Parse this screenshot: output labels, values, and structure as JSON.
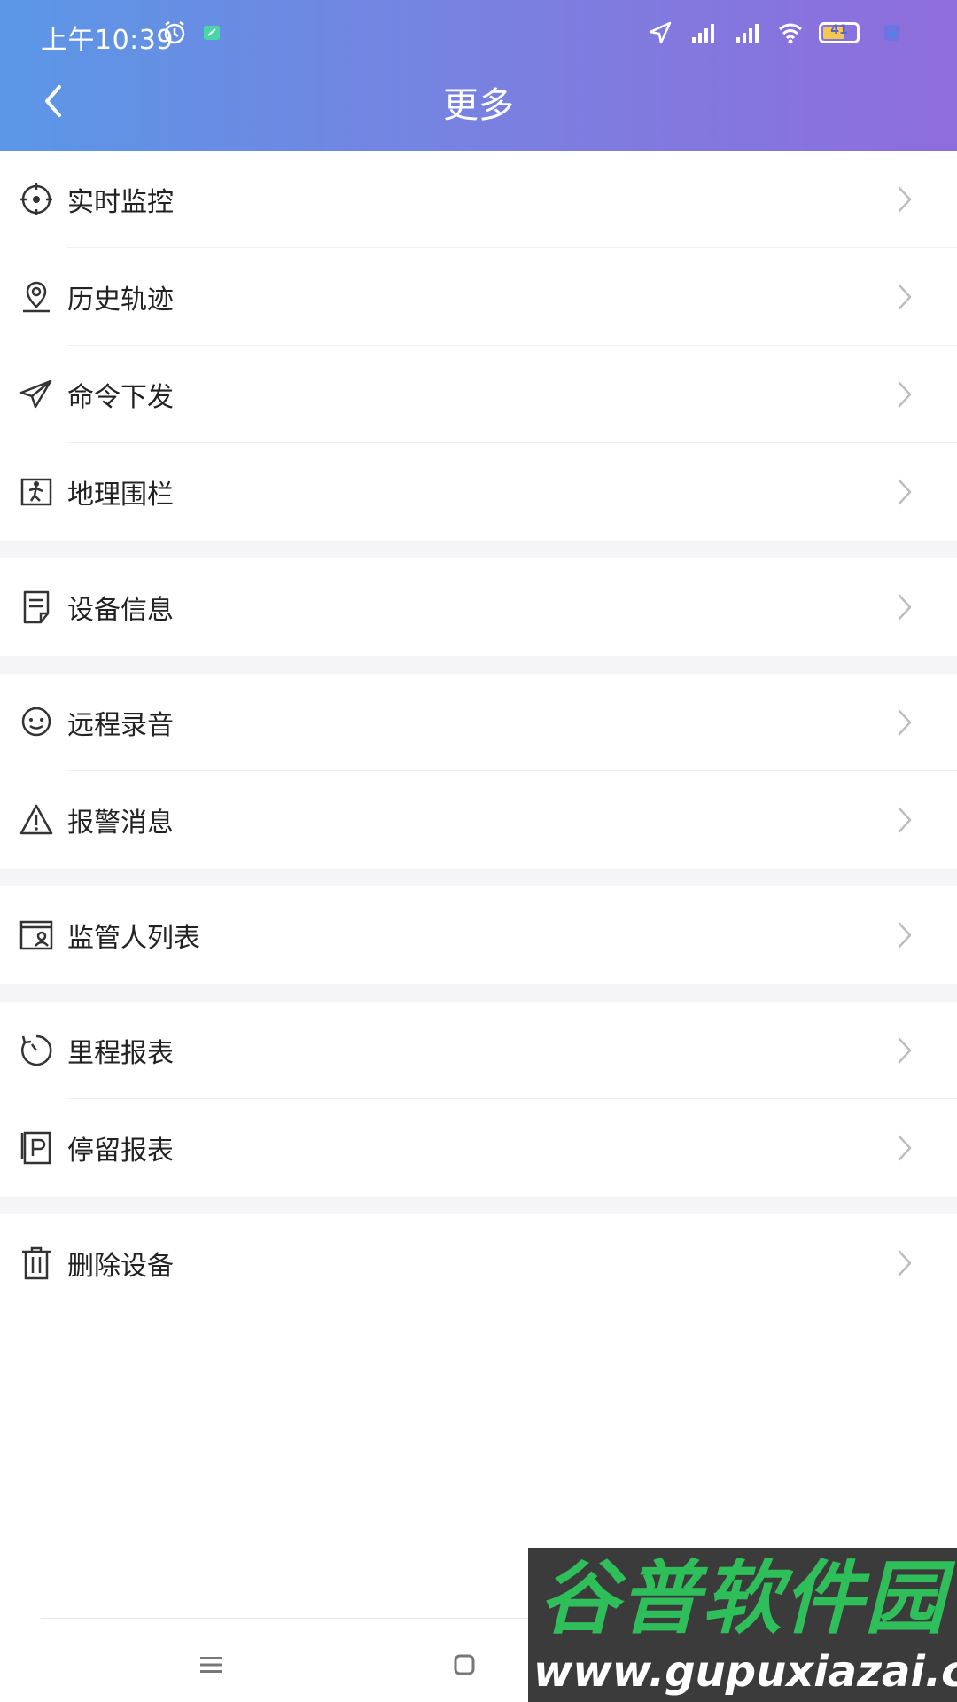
{
  "status_bar": {
    "time": "上午10:39",
    "battery": "41"
  },
  "header": {
    "title": "更多"
  },
  "menu": {
    "groups": [
      {
        "items": [
          {
            "label": "实时监控",
            "icon": "crosshair-icon"
          },
          {
            "label": "历史轨迹",
            "icon": "location-pin-icon"
          },
          {
            "label": "命令下发",
            "icon": "send-icon"
          },
          {
            "label": "地理围栏",
            "icon": "geofence-icon"
          }
        ]
      },
      {
        "items": [
          {
            "label": "设备信息",
            "icon": "document-icon"
          }
        ]
      },
      {
        "items": [
          {
            "label": "远程录音",
            "icon": "face-icon"
          },
          {
            "label": "报警消息",
            "icon": "warning-icon"
          }
        ]
      },
      {
        "items": [
          {
            "label": "监管人列表",
            "icon": "contact-card-icon"
          }
        ]
      },
      {
        "items": [
          {
            "label": "里程报表",
            "icon": "timer-icon"
          },
          {
            "label": "停留报表",
            "icon": "parking-icon"
          }
        ]
      },
      {
        "items": [
          {
            "label": "删除设备",
            "icon": "trash-icon"
          }
        ]
      }
    ]
  },
  "watermark": {
    "title": "谷普软件园",
    "url": "www.gupuxiazai.com"
  },
  "colors": {
    "header_start": "#5b97e6",
    "header_end": "#8e6ddc",
    "divider": "#efefef",
    "group_gap": "#f5f5f7"
  }
}
